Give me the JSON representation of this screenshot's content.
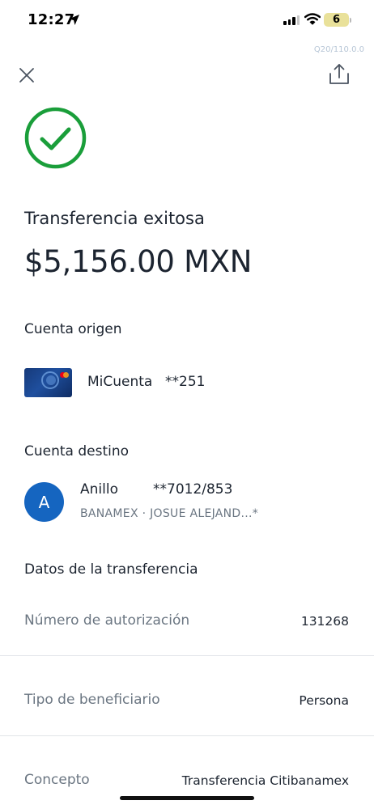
{
  "status_bar": {
    "time": "12:27",
    "battery": "6"
  },
  "app": {
    "version": "Q20/110.0.0"
  },
  "receipt": {
    "status_title": "Transferencia exitosa",
    "amount": "$5,156.00 MXN",
    "success_color": "#1a9e3a"
  },
  "origin": {
    "section_label": "Cuenta origen",
    "account_name": "MiCuenta",
    "account_mask": "**251"
  },
  "destination": {
    "section_label": "Cuenta destino",
    "avatar_letter": "A",
    "avatar_color": "#1565c0",
    "name": "Anillo",
    "account_mask": "**7012/853",
    "bank_line": "BANAMEX · JOSUE ALEJAND...*"
  },
  "transfer_details": {
    "section_label": "Datos de la transferencia",
    "rows": [
      {
        "label": "Número de autorización",
        "value": "131268"
      },
      {
        "label": "Tipo de beneficiario",
        "value": "Persona"
      },
      {
        "label": "Concepto",
        "value": "Transferencia Citibanamex"
      }
    ]
  },
  "icons": {
    "close": "close-icon",
    "share": "share-icon",
    "success": "check-circle-icon",
    "location": "location-arrow-icon",
    "signal": "cellular-signal-icon",
    "wifi": "wifi-icon"
  }
}
